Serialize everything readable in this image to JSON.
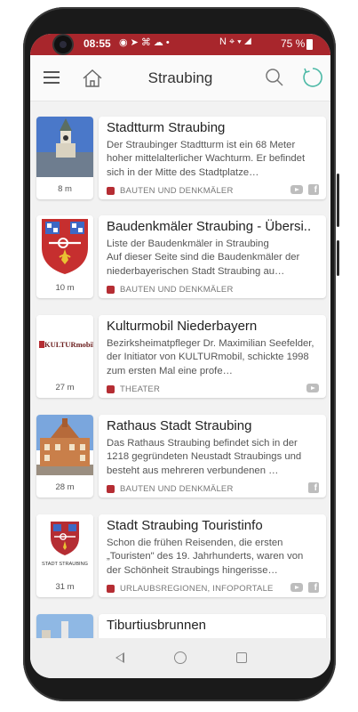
{
  "status_bar": {
    "time": "08:55",
    "battery_percent": "75 %",
    "left_icons": [
      "messenger-icon",
      "navigation-icon",
      "mouse-icon",
      "cloud-icon",
      "dot-icon"
    ],
    "right_icons": [
      "nfc-icon",
      "location-icon",
      "wifi-icon",
      "signal-icon",
      "battery-icon"
    ]
  },
  "app_bar": {
    "title": "Straubing",
    "icons": [
      "menu-icon",
      "home-icon",
      "search-icon",
      "refresh-icon"
    ]
  },
  "colors": {
    "status_bar": "#a8262c",
    "category_dot": "#b52d33",
    "refresh_accent": "#4cb9a6"
  },
  "items": [
    {
      "title": "Stadtturm Straubing",
      "description": "Der Straubinger Stadtturm ist ein 68 Meter hoher mittelalterlicher Wachturm. Er befindet sich in der Mitte des Stadtplatze…",
      "distance": "8 m",
      "category": "BAUTEN UND DENKMÄLER",
      "thumb": "tower-photo",
      "social": [
        "youtube-icon",
        "facebook-icon"
      ]
    },
    {
      "title": "Baudenkmäler Straubing - Übersi..",
      "description": "Liste der Baudenkmäler in Straubing\nAuf dieser Seite sind die Baudenkmäler der niederbayerischen Stadt Straubing au…",
      "distance": "10 m",
      "category": "BAUTEN UND DENKMÄLER",
      "thumb": "coat-of-arms",
      "social": []
    },
    {
      "title": "Kulturmobil Niederbayern",
      "description": "Bezirksheimatpfleger Dr. Maximilian Seefelder, der Initiator von KULTURmobil, schickte 1998 zum ersten Mal eine profe…",
      "distance": "27 m",
      "category": "THEATER",
      "thumb": "kulturmobil-logo",
      "thumb_logo_text": "KULTURmobil",
      "social": [
        "youtube-icon"
      ]
    },
    {
      "title": "Rathaus Stadt Straubing",
      "description": "Das Rathaus Straubing befindet sich in der 1218 gegründeten Neustadt Straubings und besteht aus mehreren verbundenen …",
      "distance": "28 m",
      "category": "BAUTEN UND DENKMÄLER",
      "thumb": "town-hall-photo",
      "social": [
        "facebook-icon"
      ]
    },
    {
      "title": "Stadt Straubing Touristinfo",
      "description": "Schon die frühen Reisenden, die ersten „Touristen\" des 19. Jahrhunderts, waren von der Schönheit Straubings hingerisse…",
      "distance": "31 m",
      "category": "URLAUBSREGIONEN, INFOPORTALE",
      "thumb": "straubing-logo",
      "thumb_logo_text": "STADT STRAUBING",
      "social": [
        "youtube-icon",
        "facebook-icon"
      ]
    },
    {
      "title": "Tiburtiusbrunnen",
      "description": "",
      "distance": "",
      "category": "",
      "thumb": "fountain-photo",
      "social": []
    }
  ],
  "nav_bar": [
    "back-icon",
    "home-button-icon",
    "recents-icon"
  ]
}
